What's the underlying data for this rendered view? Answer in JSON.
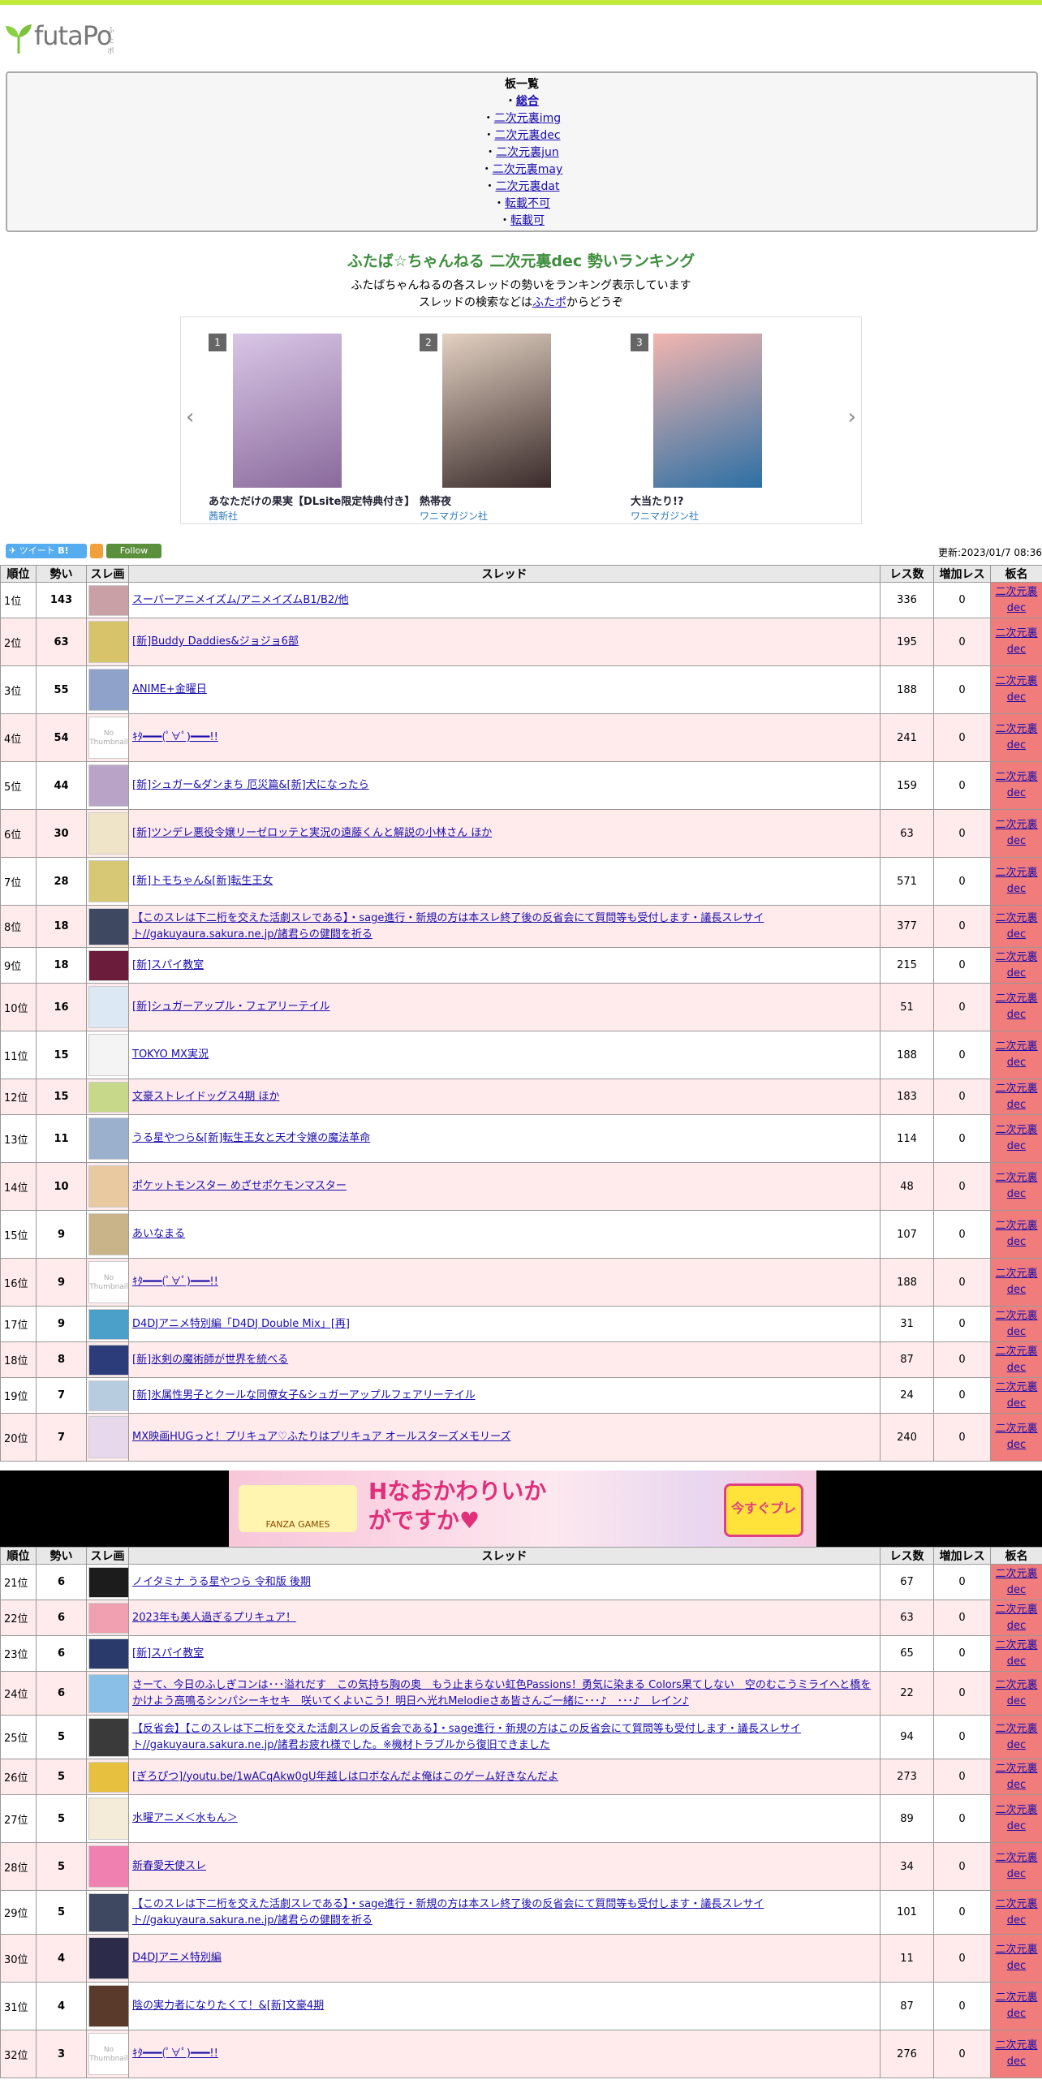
{
  "site": {
    "logo_text": "futaPo",
    "logo_sub": "ふたポ"
  },
  "board_list": {
    "title": "板一覧",
    "items": [
      {
        "label": "総合",
        "bold": true
      },
      {
        "label": "二次元裏img"
      },
      {
        "label": "二次元裏dec"
      },
      {
        "label": "二次元裏jun"
      },
      {
        "label": "二次元裏may"
      },
      {
        "label": "二次元裏dat"
      },
      {
        "label": "転載不可"
      },
      {
        "label": "転載可"
      }
    ]
  },
  "page": {
    "title": "ふたば☆ちゃんねる 二次元裏dec 勢いランキング",
    "desc_line1": "ふたばちゃんねるの各スレッドの勢いをランキング表示しています",
    "desc_line2_pre": "スレッドの検索などは",
    "desc_line2_link": "ふたポ",
    "desc_line2_post": "からどうぞ"
  },
  "carousel": {
    "prev_icon": "chevron-left-icon",
    "next_icon": "chevron-right-icon",
    "items": [
      {
        "rank": "1",
        "title": "あなただけの果実【DLsite限定特典付き】",
        "publisher": "茜新社",
        "color_a": "#d9c7e6",
        "color_b": "#8a6a9c"
      },
      {
        "rank": "2",
        "title": "熱帯夜",
        "publisher": "ワニマガジン社",
        "color_a": "#e3d2c2",
        "color_b": "#3a2a2a"
      },
      {
        "rank": "3",
        "title": "大当たり!?",
        "publisher": "ワニマガジン社",
        "color_a": "#f3b6b0",
        "color_b": "#2c6fa4"
      }
    ]
  },
  "social": {
    "tweet": "ツイート",
    "hatena": "B!",
    "follow": "Follow"
  },
  "updated": "更新:2023/01/7 08:36",
  "table_headers": [
    "順位",
    "勢い",
    "スレ画",
    "スレッド",
    "レス数",
    "増加レス",
    "板名"
  ],
  "board_name_line1": "二次元裏",
  "board_name_line2": "dec",
  "rows1": [
    {
      "rank": "1位",
      "speed": "143",
      "thread": "スーパーアニメイズム/アニメイズムB1/B2/他",
      "res": "336",
      "inc": "0",
      "thumb": "#c9a0a6"
    },
    {
      "rank": "2位",
      "speed": "63",
      "thread": "[新]Buddy Daddies&ジョジョ6部",
      "res": "195",
      "inc": "0",
      "thumb": "#d7c46a"
    },
    {
      "rank": "3位",
      "speed": "55",
      "thread": "ANIME+金曜日",
      "res": "188",
      "inc": "0",
      "thumb": "#8fa2c9"
    },
    {
      "rank": "4位",
      "speed": "54",
      "thread": "ｷﾀ━━━(ﾟ∀ﾟ)━━━!!",
      "res": "241",
      "inc": "0",
      "thumb": "nothumb"
    },
    {
      "rank": "5位",
      "speed": "44",
      "thread": "[新]シュガー&ダンまち 厄災篇&[新]犬になったら",
      "res": "159",
      "inc": "0",
      "thumb": "#b9a4c8"
    },
    {
      "rank": "6位",
      "speed": "30",
      "thread": "[新]ツンデレ悪役令嬢リーゼロッテと実況の遠藤くんと解説の小林さん ほか",
      "res": "63",
      "inc": "0",
      "thumb": "#efe3c8"
    },
    {
      "rank": "7位",
      "speed": "28",
      "thread": "[新]トモちゃん&[新]転生王女",
      "res": "571",
      "inc": "0",
      "thumb": "#d6c874"
    },
    {
      "rank": "8位",
      "speed": "18",
      "thread": "【このスレは下二桁を交えた活劇スレである】・sage進行・新規の方は本スレ終了後の反省会にて質問等も受付します・議長スレサイト//gakuyaura.sakura.ne.jp/諸君らの健闘を祈る",
      "res": "377",
      "inc": "0",
      "thumb": "#3e4860"
    },
    {
      "rank": "9位",
      "speed": "18",
      "thread": "[新]スパイ教室",
      "res": "215",
      "inc": "0",
      "thumb": "#6a1c3a"
    },
    {
      "rank": "10位",
      "speed": "16",
      "thread": "[新]シュガーアップル・フェアリーテイル",
      "res": "51",
      "inc": "0",
      "thumb": "#dce8f4"
    },
    {
      "rank": "11位",
      "speed": "15",
      "thread": "TOKYO MX実況",
      "res": "188",
      "inc": "0",
      "thumb": "#f4f4f4"
    },
    {
      "rank": "12位",
      "speed": "15",
      "thread": "文豪ストレイドッグス4期 ほか",
      "res": "183",
      "inc": "0",
      "thumb": "#c8d88a"
    },
    {
      "rank": "13位",
      "speed": "11",
      "thread": "うる星やつら&[新]転生王女と天才令嬢の魔法革命",
      "res": "114",
      "inc": "0",
      "thumb": "#9ab0cc"
    },
    {
      "rank": "14位",
      "speed": "10",
      "thread": "ポケットモンスター めざせポケモンマスター",
      "res": "48",
      "inc": "0",
      "thumb": "#e8c9a0"
    },
    {
      "rank": "15位",
      "speed": "9",
      "thread": "あいなまる",
      "res": "107",
      "inc": "0",
      "thumb": "#c9b48a"
    },
    {
      "rank": "16位",
      "speed": "9",
      "thread": "ｷﾀ━━━(ﾟ∀ﾟ)━━━!!",
      "res": "188",
      "inc": "0",
      "thumb": "nothumb"
    },
    {
      "rank": "17位",
      "speed": "9",
      "thread": "D4DJアニメ特別編「D4DJ Double Mix」[再]",
      "res": "31",
      "inc": "0",
      "thumb": "#4aa0c8"
    },
    {
      "rank": "18位",
      "speed": "8",
      "thread": "[新]氷剣の魔術師が世界を統べる",
      "res": "87",
      "inc": "0",
      "thumb": "#2c3c7a"
    },
    {
      "rank": "19位",
      "speed": "7",
      "thread": "[新]氷属性男子とクールな同僚女子&シュガーアップルフェアリーテイル",
      "res": "24",
      "inc": "0",
      "thumb": "#b8cce0"
    },
    {
      "rank": "20位",
      "speed": "7",
      "thread": "MX映画HUGっと！プリキュア♡ふたりはプリキュア オールスターズメモリーズ",
      "res": "240",
      "inc": "0",
      "thumb": "#e8d8ec"
    }
  ],
  "banner": {
    "text_main": "Hなおかわりいかがですか♥",
    "text_button": "今すぐプレイ",
    "text_brand": "FANZA GAMES"
  },
  "rows2": [
    {
      "rank": "21位",
      "speed": "6",
      "thread": "ノイタミナ うる星やつら 令和版 後期",
      "res": "67",
      "inc": "0",
      "thumb": "#1c1c1c"
    },
    {
      "rank": "22位",
      "speed": "6",
      "thread": "2023年も美人過ぎるプリキュア！",
      "res": "63",
      "inc": "0",
      "thumb": "#f0a0b0"
    },
    {
      "rank": "23位",
      "speed": "6",
      "thread": "[新]スパイ教室",
      "res": "65",
      "inc": "0",
      "thumb": "#2a3a6a"
    },
    {
      "rank": "24位",
      "speed": "6",
      "thread": "さーて、今日のふしぎコンは･･･溢れだす　この気持ち胸の奥　もう止まらない虹色Passions！勇気に染まる Colors果てしない　空のむこうミライへと橋をかけよう高鳴るシンパシーキセキ　咲いてくよいこう！明日へ光れMelodieさあ皆さんご一緒に･･･♪　･･･♪　レイン♪",
      "res": "22",
      "inc": "0",
      "thumb": "#8ac0e8"
    },
    {
      "rank": "25位",
      "speed": "5",
      "thread": "【反省会】【このスレは下二桁を交えた活劇スレの反省会である】・sage進行・新規の方はこの反省会にて質問等も受付します・議長スレサイト//gakuyaura.sakura.ne.jp/諸君お疲れ様でした。※機材トラブルから復旧できました",
      "res": "94",
      "inc": "0",
      "thumb": "#3a3a3a"
    },
    {
      "rank": "26位",
      "speed": "5",
      "thread": "[ぎろぴつ]/youtu.be/1wACqAkw0gU年越しはロボなんだよ俺はこのゲーム好きなんだよ",
      "res": "273",
      "inc": "0",
      "thumb": "#e8c040"
    },
    {
      "rank": "27位",
      "speed": "5",
      "thread": "水曜アニメ＜水もん＞",
      "res": "89",
      "inc": "0",
      "thumb": "#f4ecd8"
    },
    {
      "rank": "28位",
      "speed": "5",
      "thread": "新春愛天使スレ",
      "res": "34",
      "inc": "0",
      "thumb": "#f080b0"
    },
    {
      "rank": "29位",
      "speed": "5",
      "thread": "【このスレは下二桁を交えた活劇スレである】・sage進行・新規の方は本スレ終了後の反省会にて質問等も受付します・議長スレサイト//gakuyaura.sakura.ne.jp/諸君らの健闘を祈る",
      "res": "101",
      "inc": "0",
      "thumb": "#3e4860"
    },
    {
      "rank": "30位",
      "speed": "4",
      "thread": "D4DJアニメ特別編",
      "res": "11",
      "inc": "0",
      "thumb": "#2c2c4a"
    },
    {
      "rank": "31位",
      "speed": "4",
      "thread": "陰の実力者になりたくて！&[新]文豪4期",
      "res": "87",
      "inc": "0",
      "thumb": "#5a3a2a"
    },
    {
      "rank": "32位",
      "speed": "3",
      "thread": "ｷﾀ━━━(ﾟ∀ﾟ)━━━!!",
      "res": "276",
      "inc": "0",
      "thumb": "nothumb"
    }
  ],
  "nothumb_label": "No Thumbnail"
}
